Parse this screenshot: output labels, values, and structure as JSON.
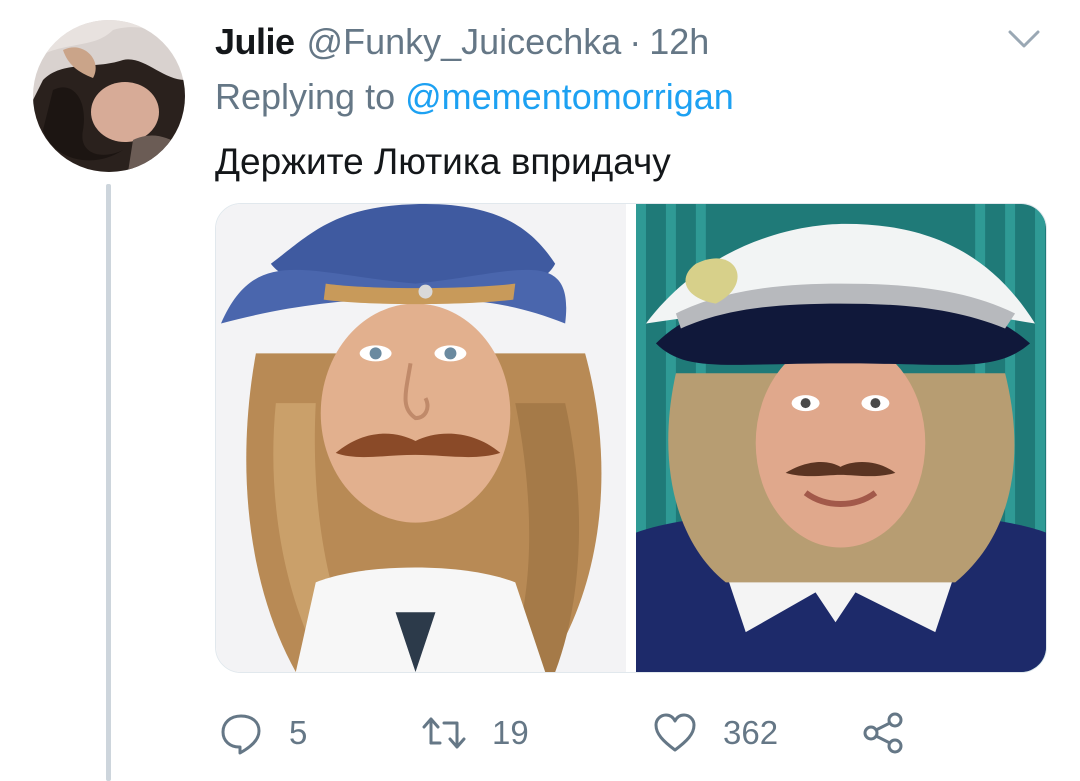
{
  "tweet": {
    "author_name": "Julie",
    "author_handle": "@Funky_Juicechka",
    "separator": "·",
    "timestamp": "12h",
    "replying_prefix": "Replying to",
    "replying_handle": "@mementomorrigan",
    "text": "Держите Лютика впридачу",
    "media": [
      {
        "kind": "photo",
        "icon": "photo-man-blue-cowboy-hat"
      },
      {
        "kind": "photo",
        "icon": "photo-man-feathered-tricorn-hat"
      }
    ]
  },
  "actions": {
    "reply_count": "5",
    "retweet_count": "19",
    "like_count": "362",
    "icons": [
      "reply-icon",
      "retweet-icon",
      "like-icon",
      "share-icon"
    ]
  },
  "colors": {
    "text_primary": "#14171a",
    "text_secondary": "#657786",
    "link": "#1da1f2",
    "thread_line": "#cdd5dc"
  }
}
